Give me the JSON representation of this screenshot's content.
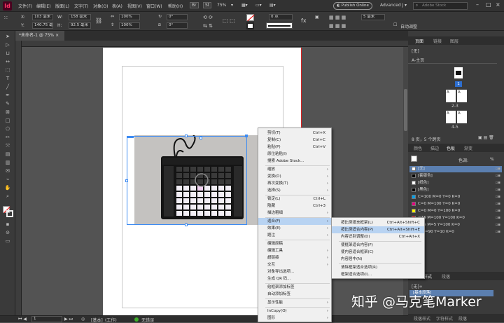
{
  "app": {
    "logo": "Id"
  },
  "menubar": {
    "items": [
      "文件(F)",
      "编辑(E)",
      "版面(L)",
      "文字(T)",
      "对象(O)",
      "表(A)",
      "视图(V)",
      "窗口(W)",
      "帮助(H)"
    ],
    "br": "Br",
    "st": "St",
    "zoom": "75%",
    "publish": "Publish Online",
    "workspace": "Advanced J",
    "search_placeholder": "Adobe Stock"
  },
  "control": {
    "x_label": "X:",
    "x": "103 毫米",
    "y_label": "Y:",
    "y": "140.75 毫米",
    "w_label": "W:",
    "w": "158 毫米",
    "h_label": "H:",
    "h": "92.5 毫米",
    "scale_x": "100%",
    "scale_y": "100%",
    "angle": "0°",
    "shear": "0°",
    "stroke_weight": "0 点",
    "frame_value": "5 毫米",
    "auto_fit": "自动调整"
  },
  "document": {
    "tab": "*未命名-1 @ 75%"
  },
  "status": {
    "page": "1",
    "style": "[基本]",
    "mode": "(工作)",
    "errors": "无错误"
  },
  "pages_panel": {
    "tabs": [
      "页面",
      "链接",
      "图层"
    ],
    "none": "[无]",
    "master": "A-主页",
    "spread_a": "A",
    "page_numbers": [
      "1",
      "2-3",
      "4-5"
    ],
    "footer": "8 页，5 个跨页"
  },
  "swatch_panel": {
    "tabs": [
      "颜色",
      "描边",
      "色板",
      "渐变"
    ],
    "tint_label": "色调:",
    "tint_unit": "%",
    "swatches": [
      {
        "name": "[无]",
        "color": "#ffffff"
      },
      {
        "name": "[套版色]",
        "color": "#000000"
      },
      {
        "name": "[纸色]",
        "color": "#ffffff"
      },
      {
        "name": "[黑色]",
        "color": "#000000"
      },
      {
        "name": "C=100 M=0 Y=0 K=0",
        "color": "#00a0e9"
      },
      {
        "name": "C=0 M=100 Y=0 K=0",
        "color": "#e4007f"
      },
      {
        "name": "C=0 M=0 Y=100 K=0",
        "color": "#fff100"
      },
      {
        "name": "=15 M=100 Y=100 K=0",
        "color": "#d7000f"
      },
      {
        "name": "=75 M=5 Y=100 K=0",
        "color": "#3fa535"
      },
      {
        "name": "0 M=90 Y=10 K=0",
        "color": "#1d2088"
      }
    ]
  },
  "para_panel": {
    "tabs": [
      "段落样式",
      "段落"
    ],
    "none": "[无]+",
    "basic": "[基本段落]",
    "bottom_tabs": [
      "段落样式",
      "字符样式",
      "段落"
    ]
  },
  "context_menu": {
    "items": [
      {
        "label": "剪切(T)",
        "shortcut": "Ctrl+X"
      },
      {
        "label": "复制(C)",
        "shortcut": "Ctrl+C"
      },
      {
        "label": "粘贴(P)",
        "shortcut": "Ctrl+V"
      },
      {
        "label": "原位粘贴(I)",
        "shortcut": ""
      },
      {
        "label": "搜索 Adobe Stock...",
        "shortcut": ""
      },
      {
        "label": "缩放",
        "arrow": true
      },
      {
        "label": "变换(O)",
        "arrow": true
      },
      {
        "label": "再次变换(T)",
        "arrow": true
      },
      {
        "label": "选择(S)",
        "arrow": true
      },
      {
        "label": "锁定(L)",
        "shortcut": "Ctrl+L"
      },
      {
        "label": "隐藏",
        "shortcut": "Ctrl+3"
      },
      {
        "label": "描边粗细",
        "arrow": true
      },
      {
        "label": "适合(F)",
        "arrow": true,
        "highlight": true
      },
      {
        "label": "效果(E)",
        "arrow": true
      },
      {
        "label": "题注",
        "arrow": true
      },
      {
        "label": "编辑原稿"
      },
      {
        "label": "编辑工具",
        "arrow": true
      },
      {
        "label": "超链接",
        "arrow": true
      },
      {
        "label": "交互",
        "arrow": true
      },
      {
        "label": "对象导出选项..."
      },
      {
        "label": "生成 QR 码..."
      },
      {
        "label": "给框架添加标签"
      },
      {
        "label": "自动添加标签"
      },
      {
        "label": "显示性能",
        "arrow": true
      },
      {
        "label": "InCopy(O)",
        "arrow": true
      },
      {
        "label": "图形",
        "arrow": true
      }
    ]
  },
  "submenu": {
    "items": [
      {
        "label": "按比例填充框架(L)",
        "shortcut": "Ctrl+Alt+Shift+C"
      },
      {
        "label": "按比例适合内容(P)",
        "shortcut": "Ctrl+Alt+Shift+E",
        "highlight": true
      },
      {
        "label": "内容识别调整(D)",
        "shortcut": "Ctrl+Alt+X"
      },
      {
        "label": "使框架适合内容(F)",
        "shortcut": ""
      },
      {
        "label": "使内容适合框架(C)",
        "shortcut": ""
      },
      {
        "label": "内容居中(N)",
        "shortcut": ""
      },
      {
        "label": "清除框架适合选项(R)",
        "shortcut": ""
      },
      {
        "label": "框架适合选项(I)...",
        "shortcut": ""
      }
    ]
  },
  "watermark": "知乎 @马克笔Marker"
}
